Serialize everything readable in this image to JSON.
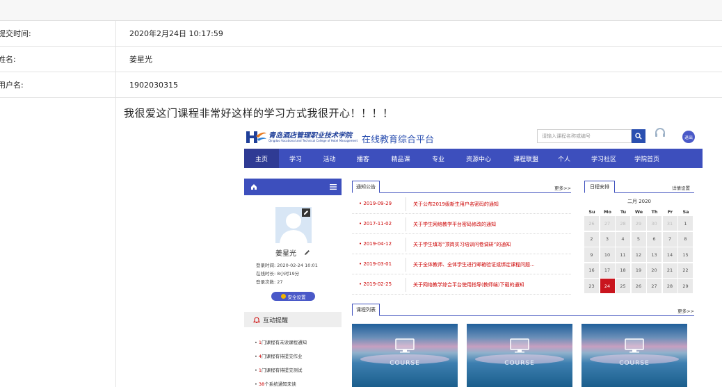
{
  "form": {
    "rows": [
      {
        "label": "提交时间:",
        "value": "2020年2月24日 10:17:59"
      },
      {
        "label": "姓名:",
        "value": "姜星光"
      },
      {
        "label": "用户名:",
        "value": "1902030315"
      }
    ],
    "content": "我很爱这门课程非常好这样的学习方式我很开心！！！！"
  },
  "portal": {
    "school_cn": "青岛酒店管理职业技术学院",
    "school_en": "Qingdao Vocational and Technical College of Hotel Management",
    "platform_name": "在线教育综合平台",
    "search_placeholder": "请输入课程名称或编号",
    "exit_label": "退出",
    "nav": [
      "主页",
      "学习",
      "活动",
      "播客",
      "精品课",
      "专业",
      "资源中心",
      "课程联盟",
      "个人",
      "学习社区",
      "学院首页"
    ],
    "user": {
      "name": "姜星光",
      "login_time": "登录时间: 2020-02-24 10:01",
      "online_time": "在线时长: 8小时19分",
      "login_count": "登录次数: 27",
      "safe_label": "安全设置"
    },
    "remind": {
      "title": "互动提醒",
      "items": [
        {
          "num": "1",
          "text": "门课程有未读课程通知"
        },
        {
          "num": "4",
          "text": "门课程有待提交作业"
        },
        {
          "num": "1",
          "text": "门课程有待提交测试"
        },
        {
          "num": "38",
          "text": "个系统通知未读"
        }
      ]
    },
    "notices": {
      "tab": "通知公告",
      "more": "更多>>",
      "items": [
        {
          "date": "2019-09-29",
          "title": "关于公布2019级新生用户名密码的通知"
        },
        {
          "date": "2017-11-02",
          "title": "关于学生网络教学平台密码修改的通知"
        },
        {
          "date": "2019-04-12",
          "title": "关于学生填写“顶岗实习培训问卷调研”的通知"
        },
        {
          "date": "2019-03-01",
          "title": "关于全体教师、全体学生进行邮箱验证或绑定课程问题..."
        },
        {
          "date": "2019-02-25",
          "title": "关于网络教学综合平台使用指导(教师端)下载的通知"
        }
      ]
    },
    "calendar": {
      "tab": "日程安排",
      "settings": "详情设置",
      "title": "二月 2020",
      "dow": [
        "Su",
        "Mo",
        "Tu",
        "We",
        "Th",
        "Fr",
        "Sa"
      ],
      "weeks": [
        [
          {
            "d": "26",
            "m": true
          },
          {
            "d": "27",
            "m": true
          },
          {
            "d": "28",
            "m": true
          },
          {
            "d": "29",
            "m": true
          },
          {
            "d": "30",
            "m": true
          },
          {
            "d": "31",
            "m": true
          },
          {
            "d": "1"
          }
        ],
        [
          {
            "d": "2"
          },
          {
            "d": "3"
          },
          {
            "d": "4"
          },
          {
            "d": "5"
          },
          {
            "d": "6"
          },
          {
            "d": "7"
          },
          {
            "d": "8"
          }
        ],
        [
          {
            "d": "9"
          },
          {
            "d": "10"
          },
          {
            "d": "11"
          },
          {
            "d": "12"
          },
          {
            "d": "13"
          },
          {
            "d": "14"
          },
          {
            "d": "15"
          }
        ],
        [
          {
            "d": "16"
          },
          {
            "d": "17"
          },
          {
            "d": "18"
          },
          {
            "d": "19"
          },
          {
            "d": "20"
          },
          {
            "d": "21"
          },
          {
            "d": "22"
          }
        ],
        [
          {
            "d": "23"
          },
          {
            "d": "24",
            "t": true
          },
          {
            "d": "25"
          },
          {
            "d": "26"
          },
          {
            "d": "27"
          },
          {
            "d": "28"
          },
          {
            "d": "29"
          }
        ]
      ]
    },
    "courses": {
      "tab": "课程列表",
      "more": "更多>>",
      "items": [
        {
          "label": "COURSE"
        },
        {
          "label": "COURSE"
        },
        {
          "label": "COURSE"
        }
      ]
    },
    "colors": {
      "nav": "#3d4fbd",
      "accent_red": "#cc0000",
      "today": "#c9151e"
    }
  }
}
